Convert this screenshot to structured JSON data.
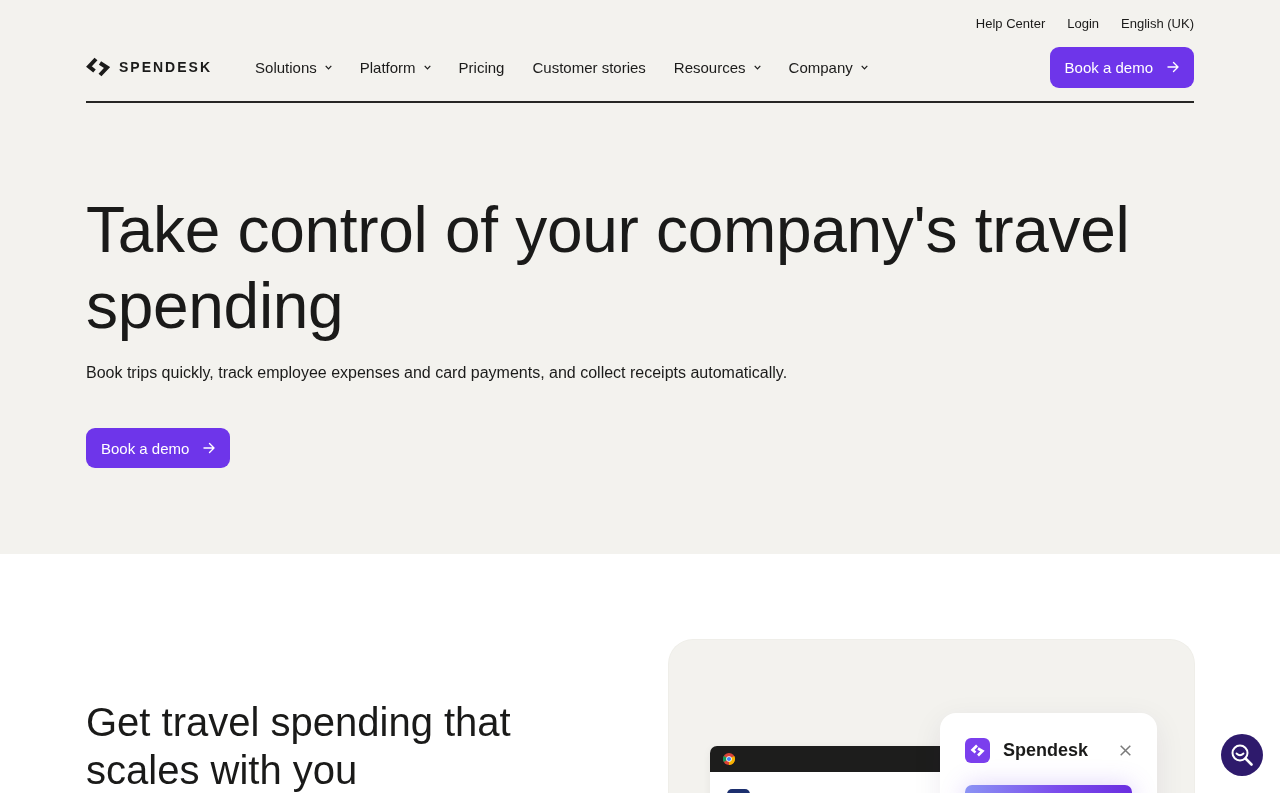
{
  "utility_links": [
    {
      "label": "Help Center"
    },
    {
      "label": "Login"
    },
    {
      "label": "English (UK)"
    }
  ],
  "header": {
    "logo_text": "SPENDESK",
    "nav": [
      {
        "label": "Solutions",
        "has_menu": true
      },
      {
        "label": "Platform",
        "has_menu": true
      },
      {
        "label": "Pricing",
        "has_menu": false
      },
      {
        "label": "Customer stories",
        "has_menu": false
      },
      {
        "label": "Resources",
        "has_menu": true
      },
      {
        "label": "Company",
        "has_menu": true
      }
    ],
    "cta": "Book a demo"
  },
  "hero": {
    "title": "Take control of your company's travel spending",
    "subtitle": "Book trips quickly, track employee expenses and card payments, and collect receipts automatically.",
    "cta": "Book a demo"
  },
  "feature": {
    "title": "Get travel spending that scales with you",
    "popup": {
      "app_name": "Spendesk"
    }
  }
}
